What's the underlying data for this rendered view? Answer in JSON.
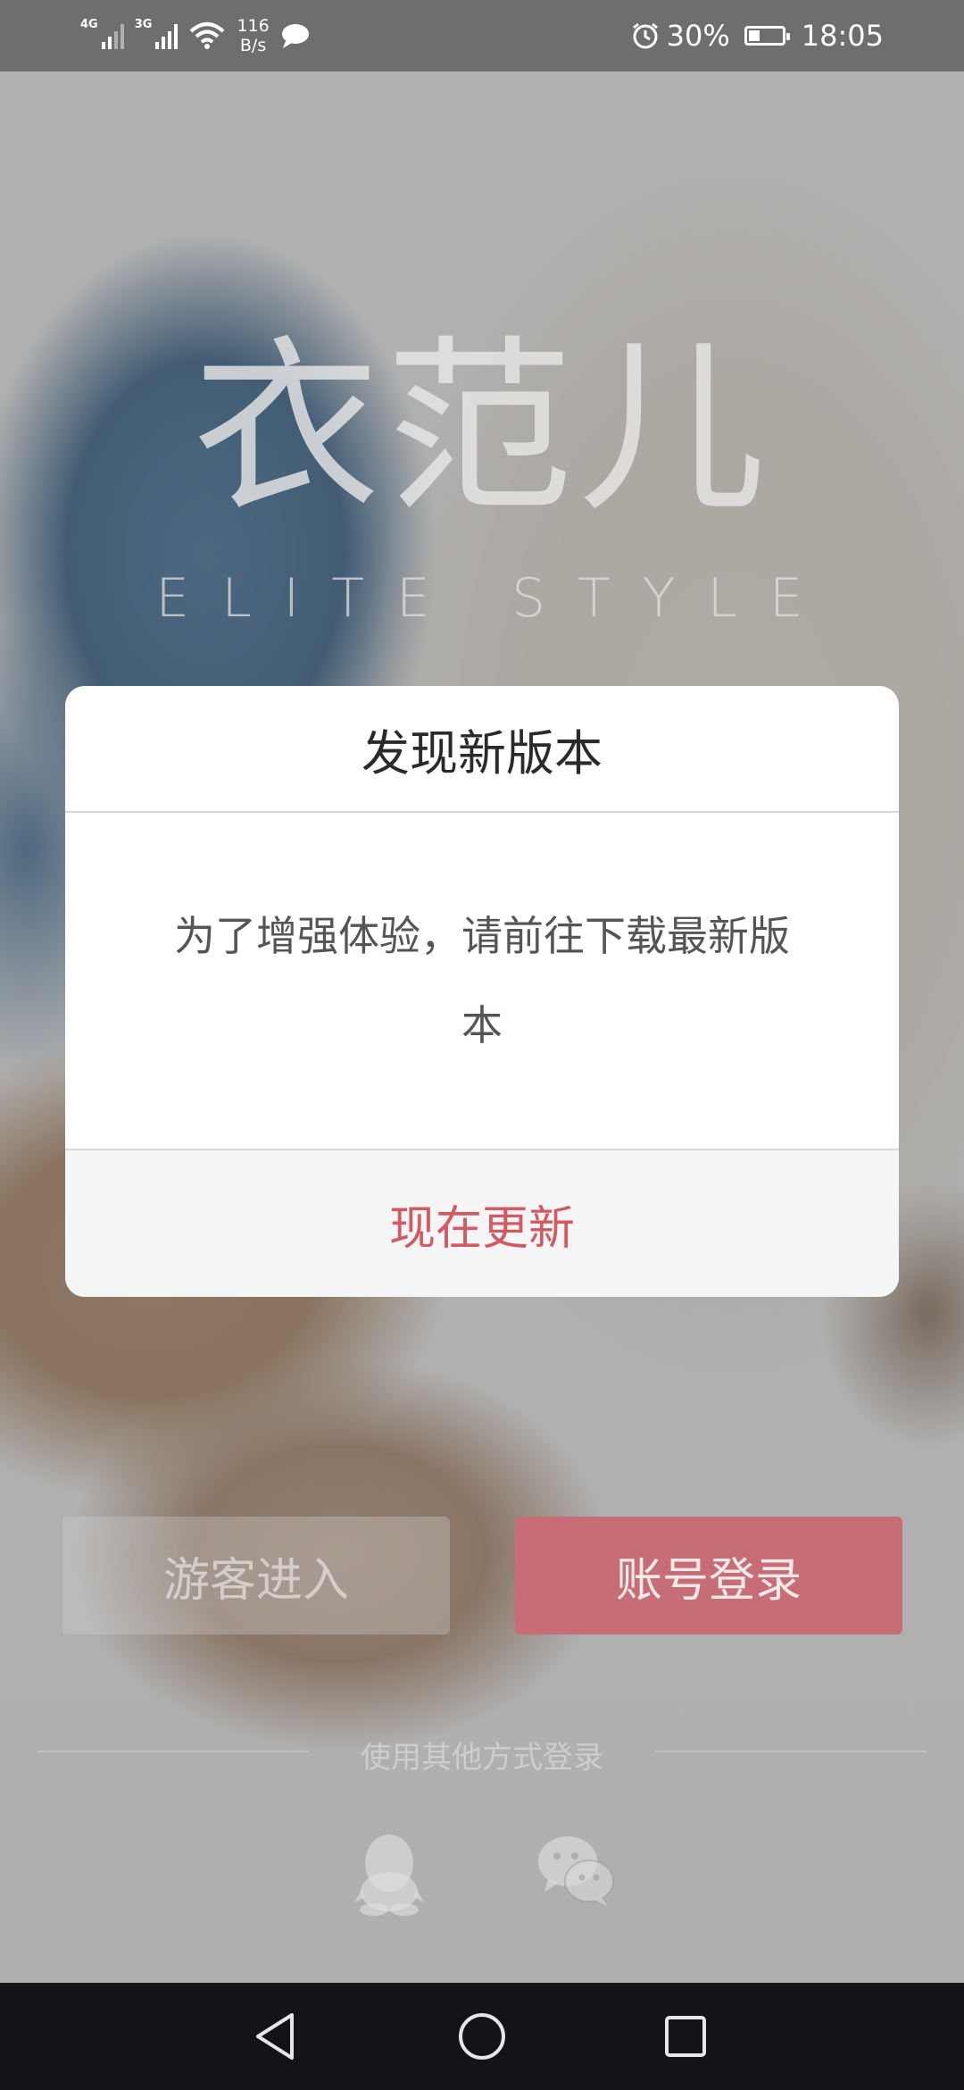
{
  "status_bar": {
    "network1": "4G",
    "network2": "3G",
    "speed_value": "116",
    "speed_unit": "B/s",
    "battery": "30%",
    "time": "18:05",
    "icons": [
      "signal-icon",
      "wifi-icon",
      "message-icon",
      "alarm-icon",
      "battery-charging-icon"
    ]
  },
  "logo": {
    "main": "衣范儿",
    "sub": "ELITE STYLE"
  },
  "dialog": {
    "title": "发现新版本",
    "message": "为了增强体验，请前往下载最新版本",
    "action": "现在更新",
    "action_color": "#d15a63"
  },
  "login": {
    "guest_button": "游客进入",
    "account_button": "账号登录",
    "account_button_color": "#c66d76",
    "other_methods": "使用其他方式登录",
    "social_icons": [
      "qq-icon",
      "wechat-icon"
    ]
  },
  "nav_bar": {
    "icons": [
      "back-icon",
      "home-icon",
      "recent-apps-icon"
    ]
  }
}
